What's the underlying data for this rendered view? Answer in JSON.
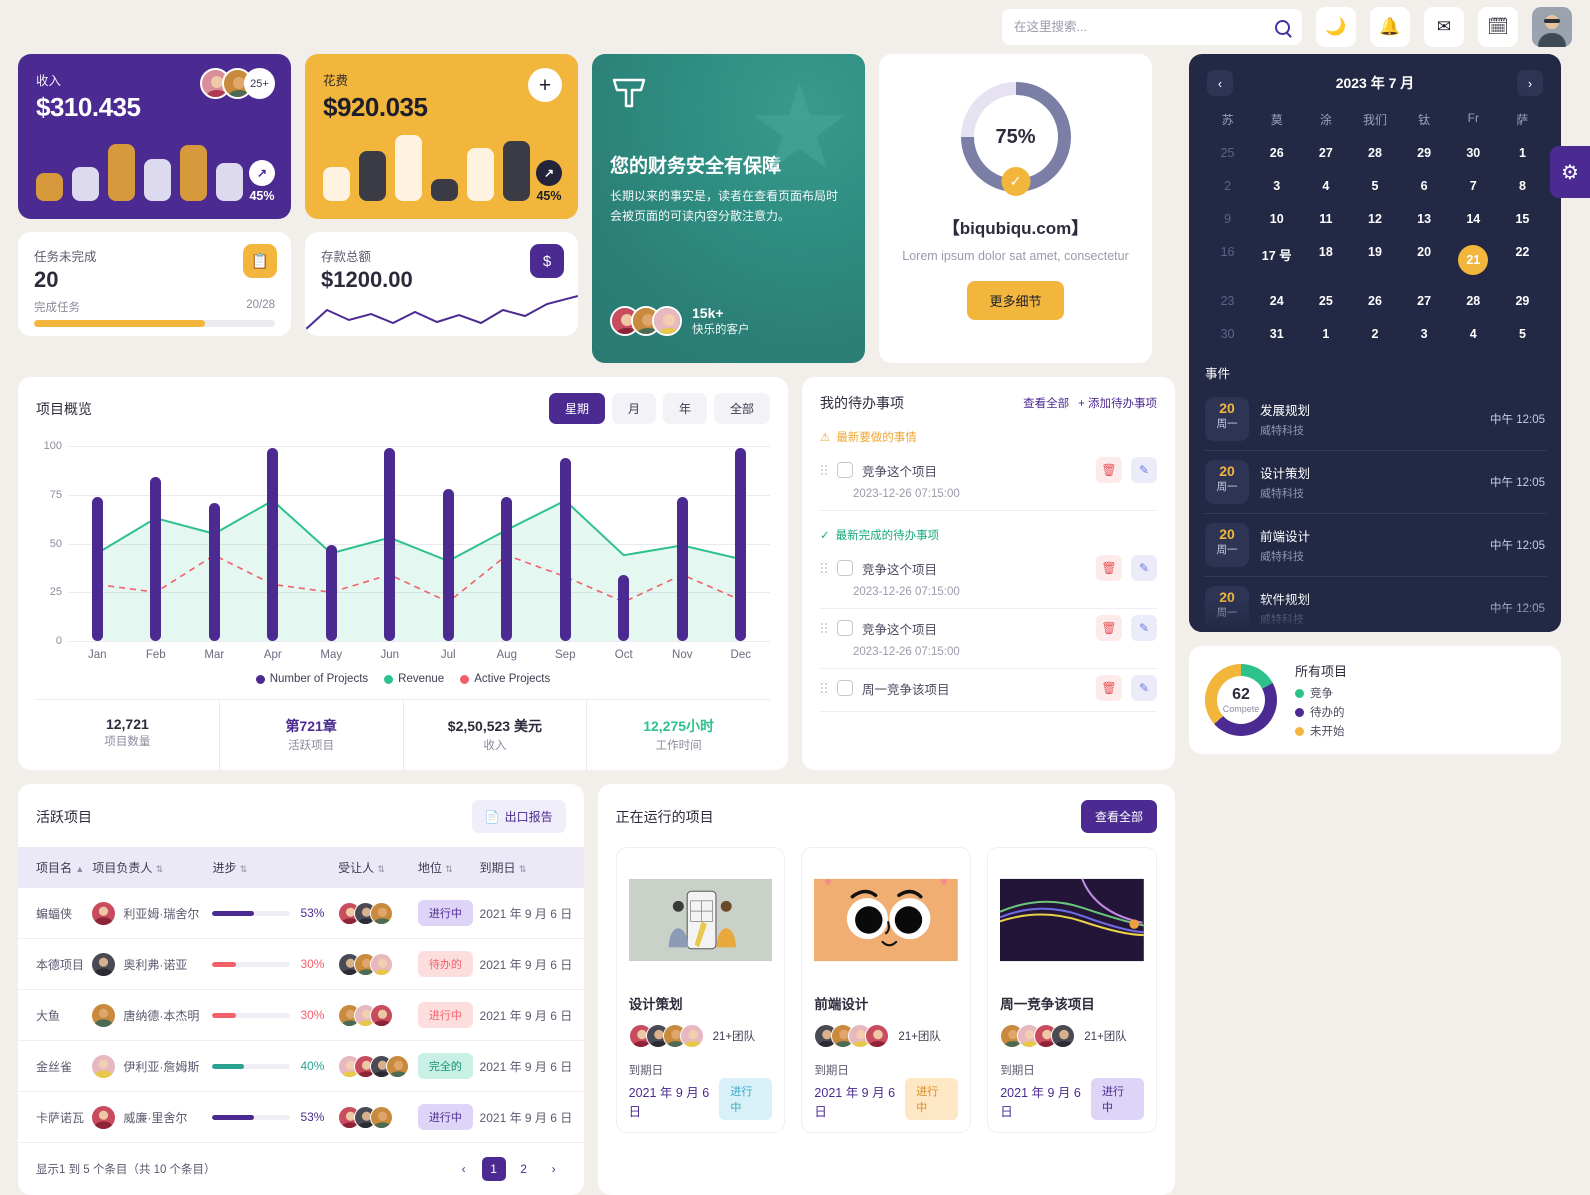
{
  "header": {
    "search_placeholder": "在这里搜索...",
    "search_value": "",
    "icons": [
      "moon-icon",
      "bell-icon",
      "mail-icon",
      "calendar-icon"
    ]
  },
  "revenue_card": {
    "label": "收入",
    "value": "$310.435",
    "avatar_more": "25+",
    "pct": "45%",
    "arrow": "↗"
  },
  "expense_card": {
    "label": "花费",
    "value": "$920.035",
    "plus": "+",
    "pct": "45%",
    "arrow": "↗"
  },
  "tasks_card": {
    "label": "任务未完成",
    "value": "20",
    "sub": "完成任务",
    "ratio": "20/28",
    "progress": 71,
    "icon": "clipboard-icon"
  },
  "savings_card": {
    "label": "存款总额",
    "value": "$1200.00",
    "icon": "dollar-icon"
  },
  "promo_card": {
    "title": "您的财务安全有保障",
    "body": "长期以来的事实是，读者在查看页面布局时会被页面的可读内容分散注意力。",
    "count": "15k+",
    "count_label": "快乐的客户"
  },
  "progress_card": {
    "percent": "75%",
    "percent_value": 75,
    "brand": "【biqubiqu.com】",
    "sub": "Lorem ipsum dolor sat amet, consectetur",
    "button": "更多细节"
  },
  "calendar": {
    "title": "2023 年 7 月",
    "prev": "‹",
    "next": "›",
    "dow": [
      "苏",
      "莫",
      "涂",
      "我们",
      "钛",
      "Fr",
      "萨"
    ],
    "weeks": [
      [
        {
          "d": "25",
          "mut": true
        },
        {
          "d": "26"
        },
        {
          "d": "27"
        },
        {
          "d": "28"
        },
        {
          "d": "29"
        },
        {
          "d": "30"
        },
        {
          "d": "1"
        }
      ],
      [
        {
          "d": "2",
          "mut": true
        },
        {
          "d": "3"
        },
        {
          "d": "4"
        },
        {
          "d": "5"
        },
        {
          "d": "6"
        },
        {
          "d": "7"
        },
        {
          "d": "8"
        }
      ],
      [
        {
          "d": "9",
          "mut": true
        },
        {
          "d": "10"
        },
        {
          "d": "11"
        },
        {
          "d": "12"
        },
        {
          "d": "13"
        },
        {
          "d": "14"
        },
        {
          "d": "15"
        }
      ],
      [
        {
          "d": "16",
          "mut": true
        },
        {
          "d": "17 号"
        },
        {
          "d": "18"
        },
        {
          "d": "19"
        },
        {
          "d": "20"
        },
        {
          "d": "21",
          "sel": true
        },
        {
          "d": "22"
        }
      ],
      [
        {
          "d": "23",
          "mut": true
        },
        {
          "d": "24"
        },
        {
          "d": "25"
        },
        {
          "d": "26"
        },
        {
          "d": "27"
        },
        {
          "d": "28"
        },
        {
          "d": "29"
        }
      ],
      [
        {
          "d": "30",
          "mut": true
        },
        {
          "d": "31"
        },
        {
          "d": "1"
        },
        {
          "d": "2"
        },
        {
          "d": "3"
        },
        {
          "d": "4"
        },
        {
          "d": "5"
        }
      ]
    ],
    "events_title": "事件",
    "events": [
      {
        "day": "20",
        "weekday": "周一",
        "name": "发展规划",
        "company": "威特科技",
        "time": "中午 12:05"
      },
      {
        "day": "20",
        "weekday": "周一",
        "name": "设计策划",
        "company": "威特科技",
        "time": "中午 12:05"
      },
      {
        "day": "20",
        "weekday": "周一",
        "name": "前端设计",
        "company": "威特科技",
        "time": "中午 12:05"
      },
      {
        "day": "20",
        "weekday": "周一",
        "name": "软件规划",
        "company": "威特科技",
        "time": "中午 12:05"
      }
    ]
  },
  "chart_card": {
    "title": "项目概览",
    "segments": [
      {
        "label": "星期",
        "active": true
      },
      {
        "label": "月",
        "active": false
      },
      {
        "label": "年",
        "active": false
      },
      {
        "label": "全部",
        "active": false
      }
    ],
    "kpis": [
      {
        "value": "12,721",
        "label": "项目数量",
        "color": "#2b2b3c"
      },
      {
        "value": "第721章",
        "label": "活跃项目",
        "color": "#4b2a91"
      },
      {
        "value": "$2,50,523 美元",
        "label": "收入",
        "color": "#2b2b3c"
      },
      {
        "value": "12,275小时",
        "label": "工作时间",
        "color": "#2ec28b"
      }
    ]
  },
  "chart_data": {
    "type": "bar",
    "title": "项目概览",
    "xlabel": "",
    "ylabel": "",
    "ylim": [
      0,
      100
    ],
    "yticks": [
      0,
      25,
      50,
      75,
      100
    ],
    "grid": true,
    "legend_position": "bottom",
    "categories": [
      "Jan",
      "Feb",
      "Mar",
      "Apr",
      "May",
      "Jun",
      "Jul",
      "Aug",
      "Sep",
      "Oct",
      "Nov",
      "Dec"
    ],
    "series": [
      {
        "name": "Number of Projects",
        "type": "bar",
        "color": "#4b2a91",
        "values": [
          74,
          84,
          71,
          99,
          49,
          99,
          78,
          74,
          94,
          34,
          74,
          99
        ]
      },
      {
        "name": "Revenue",
        "type": "area",
        "color": "#2ec28b",
        "values": [
          45,
          63,
          55,
          72,
          45,
          53,
          41,
          57,
          72,
          44,
          49,
          42
        ]
      },
      {
        "name": "Active Projects",
        "type": "line-dashed",
        "color": "#f4606a",
        "values": [
          29,
          25,
          44,
          29,
          25,
          34,
          20,
          44,
          33,
          20,
          34,
          21
        ]
      }
    ]
  },
  "todo": {
    "title": "我的待办事项",
    "view_all": "查看全部",
    "add": "+ 添加待办事项",
    "section_pending": "最新要做的事情",
    "section_done": "最新完成的待办事项",
    "items": [
      {
        "text": "竞争这个项目",
        "date": "2023-12-26 07:15:00",
        "section": "pending"
      },
      {
        "text": "竞争这个项目",
        "date": "2023-12-26 07:15:00",
        "section": "done"
      },
      {
        "text": "竞争这个项目",
        "date": "2023-12-26 07:15:00",
        "section": ""
      },
      {
        "text": "周一竞争该项目",
        "date": "",
        "section": ""
      }
    ]
  },
  "donut_card": {
    "center_value": "62",
    "center_label": "Compete",
    "title": "所有项目",
    "legend": [
      {
        "label": "竞争",
        "color": "#2ec28b"
      },
      {
        "label": "待办的",
        "color": "#4b2a91"
      },
      {
        "label": "未开始",
        "color": "#f2b63c"
      }
    ]
  },
  "table": {
    "title": "活跃项目",
    "export": "出口报告",
    "columns": [
      "项目名",
      "项目负责人",
      "进步",
      "受让人",
      "地位",
      "到期日"
    ],
    "rows": [
      {
        "name": "蝙蝠侠",
        "owner": "利亚姆·瑞舍尔",
        "progress": "53%",
        "pval": 53,
        "pcolor": "#4b2a91",
        "status": "进行中",
        "sbg": "#ddd4f7",
        "scolor": "#4b2a91",
        "due": "2021 年 9 月 6 日",
        "assignees": 3
      },
      {
        "name": "本德项目",
        "owner": "奥利弗·诺亚",
        "progress": "30%",
        "pval": 30,
        "pcolor": "#f4606a",
        "status": "待办的",
        "sbg": "#fddedf",
        "scolor": "#f4606a",
        "due": "2021 年 9 月 6 日",
        "assignees": 3
      },
      {
        "name": "大鱼",
        "owner": "唐纳德·本杰明",
        "progress": "30%",
        "pval": 30,
        "pcolor": "#f4606a",
        "status": "进行中",
        "sbg": "#fddedf",
        "scolor": "#f4606a",
        "due": "2021 年 9 月 6 日",
        "assignees": 3
      },
      {
        "name": "金丝雀",
        "owner": "伊利亚·詹姆斯",
        "progress": "40%",
        "pval": 40,
        "pcolor": "#2aa391",
        "status": "完全的",
        "sbg": "#c8f0e4",
        "scolor": "#1c8f75",
        "due": "2021 年 9 月 6 日",
        "assignees": 4
      },
      {
        "name": "卡萨诺瓦",
        "owner": "威廉·里舍尔",
        "progress": "53%",
        "pval": 53,
        "pcolor": "#4b2a91",
        "status": "进行中",
        "sbg": "#ddd4f7",
        "scolor": "#4b2a91",
        "due": "2021 年 9 月 6 日",
        "assignees": 3
      }
    ],
    "footer": "显示1 到 5 个条目（共 10 个条目）",
    "pages": [
      "1",
      "2"
    ],
    "prev": "‹",
    "next": "›"
  },
  "running": {
    "title": "正在运行的项目",
    "view_all": "查看全部",
    "projects": [
      {
        "name": "设计策划",
        "team": "21+团队",
        "due_label": "到期日",
        "due": "2021 年 9 月 6 日",
        "status": "进行中",
        "sbg": "#d8f0f7",
        "scolor": "#3aa8c4",
        "thumb": "wireframe-illustration"
      },
      {
        "name": "前端设计",
        "team": "21+团队",
        "due_label": "到期日",
        "due": "2021 年 9 月 6 日",
        "status": "进行中",
        "sbg": "#fde7c4",
        "scolor": "#d98b20",
        "thumb": "cat-face-illustration"
      },
      {
        "name": "周一竞争该项目",
        "team": "21+团队",
        "due_label": "到期日",
        "due": "2021 年 9 月 6 日",
        "status": "进行中",
        "sbg": "#ddd4f7",
        "scolor": "#4b2a91",
        "thumb": "abstract-lines-illustration"
      }
    ]
  },
  "settings_tab": {
    "icon": "gear-icon"
  }
}
